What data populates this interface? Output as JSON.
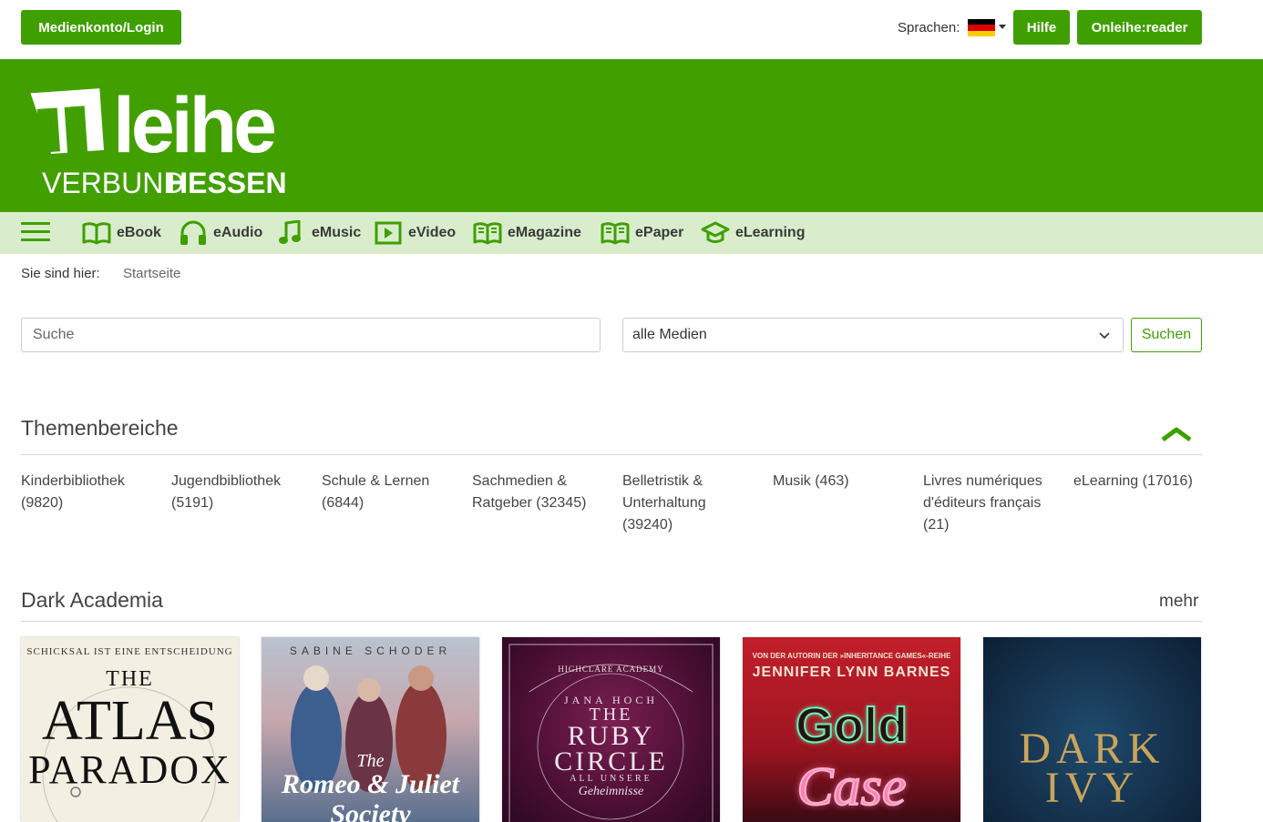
{
  "header": {
    "login_label": "Medienkonto/Login",
    "language_label": "Sprachen:",
    "help_label": "Hilfe",
    "reader_label": "Onleihe:reader"
  },
  "logo": {
    "line1": "onleihe",
    "line2_light": "VERBUND",
    "line2_bold": "HESSEN",
    "brand_color": "#41a000"
  },
  "nav": {
    "items": [
      {
        "label": "eBook",
        "icon": "book-icon"
      },
      {
        "label": "eAudio",
        "icon": "headphones-icon"
      },
      {
        "label": "eMusic",
        "icon": "music-note-icon"
      },
      {
        "label": "eVideo",
        "icon": "video-play-icon"
      },
      {
        "label": "eMagazine",
        "icon": "magazine-icon"
      },
      {
        "label": "ePaper",
        "icon": "paper-icon"
      },
      {
        "label": "eLearning",
        "icon": "graduation-cap-icon"
      }
    ]
  },
  "breadcrumb": {
    "label": "Sie sind hier:",
    "current": "Startseite"
  },
  "search": {
    "placeholder": "Suche",
    "media_selected": "alle Medien",
    "button_label": "Suchen"
  },
  "topics": {
    "title": "Themenbereiche",
    "items": [
      {
        "label": "Kinderbibliothek (9820)"
      },
      {
        "label": "Jugendbibliothek (5191)"
      },
      {
        "label": "Schule & Lernen (6844)"
      },
      {
        "label": "Sachmedien & Ratgeber (32345)"
      },
      {
        "label": "Belletristik & Unterhaltung (39240)"
      },
      {
        "label": "Musik (463)"
      },
      {
        "label": "Livres numériques d'éditeurs français (21)"
      },
      {
        "label": "eLearning (17016)"
      }
    ]
  },
  "dark_academia": {
    "title": "Dark Academia",
    "more_label": "mehr",
    "covers": [
      {
        "top": "SCHICKSAL IST EINE ENTSCHEIDUNG",
        "l1": "THE",
        "l2": "ATLAS",
        "l3": "PARADOX"
      },
      {
        "top": "SABINE SCHODER",
        "l1": "The",
        "l2": "Romeo & Juliet",
        "l3": "Society"
      },
      {
        "top": "HIGHCLARE ACADEMY",
        "author": "JANA HOCH",
        "l1": "THE",
        "l2": "RUBY",
        "l3": "CIRCLE",
        "l4": "ALL UNSERE",
        "l5": "Geheimnisse"
      },
      {
        "top": "VON DER AUTORIN DER »INHERITANCE GAMES«-REIHE",
        "author": "JENNIFER LYNN BARNES",
        "l1": "Gold",
        "l2": "Case"
      },
      {
        "l1": "DARK",
        "l2": "IVY"
      }
    ]
  }
}
